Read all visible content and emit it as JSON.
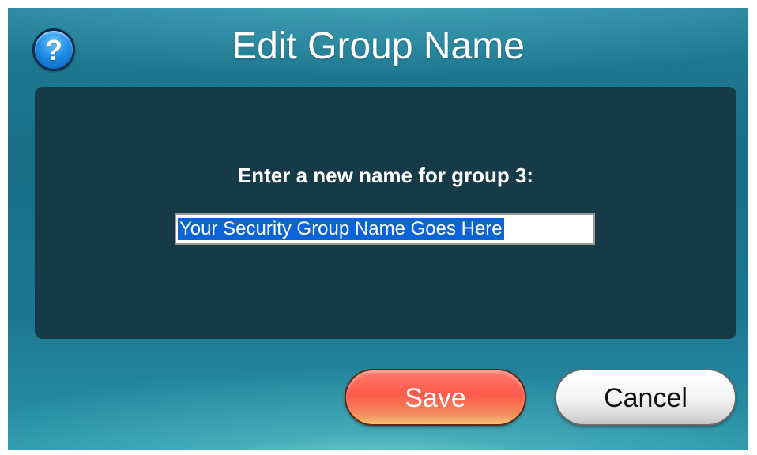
{
  "dialog": {
    "title": "Edit Group Name",
    "help_icon": "question-mark-icon",
    "help_glyph": "?",
    "prompt": "Enter a new name for group 3:",
    "group_name_value": "Your Security Group Name Goes Here",
    "group_name_selected": true
  },
  "buttons": {
    "save_label": "Save",
    "cancel_label": "Cancel"
  },
  "colors": {
    "background_teal": "#1f7d95",
    "panel": "#173a47",
    "save_button": "#ff5a4b",
    "cancel_button": "#f4f4f4",
    "selection_highlight": "#0a64d8"
  }
}
